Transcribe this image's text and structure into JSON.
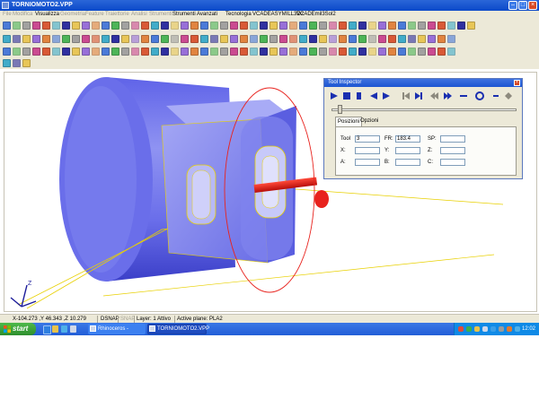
{
  "window": {
    "title": "TORNIOMOTO2.VPP"
  },
  "menu": [
    "File",
    "Modifica",
    "Visualizza",
    "Geometria",
    "Feature",
    "Traiettorie",
    "Analisi",
    "Strumenti",
    "Strumenti Avanzati",
    "Tecnologia",
    "VCADEASYMILL3D2",
    "VCADEmil3Sol2"
  ],
  "menu_enabled": [
    false,
    false,
    true,
    false,
    false,
    false,
    false,
    false,
    true,
    true,
    true,
    true
  ],
  "tool_inspector": {
    "title": "Tool Inspector",
    "close": "×",
    "tabs": [
      "Posizioni",
      "Opzioni"
    ],
    "fields": {
      "tool": {
        "label": "Tool",
        "value": "3"
      },
      "fr": {
        "label": "FR:",
        "value": "183.4"
      },
      "sp": {
        "label": "SP:",
        "value": ""
      },
      "x": {
        "label": "X:",
        "value": ""
      },
      "y": {
        "label": "Y:",
        "value": ""
      },
      "z": {
        "label": "Z:",
        "value": ""
      },
      "a": {
        "label": "A:",
        "value": ""
      },
      "b": {
        "label": "B:",
        "value": ""
      },
      "c": {
        "label": "C:",
        "value": ""
      }
    }
  },
  "status": {
    "coords": "X-104.273 ,Y 46.343 ,Z 10.279",
    "dsnap": "DSNAP",
    "snap": "SNAP",
    "layer": "Layer: 1 Attivo",
    "plane": "Active plane: PLA2"
  },
  "axis_label": "Z",
  "taskbar": {
    "start": "start",
    "tasks": [
      "Rhinoceros - C:\\Docu...",
      "TORNIOMOTO2.VPP"
    ],
    "clock": "12:02"
  },
  "colors": {
    "part": "#8a8ef0",
    "tool": "#e8231e",
    "path": "#e8d000",
    "accent": "#1c55d1"
  }
}
